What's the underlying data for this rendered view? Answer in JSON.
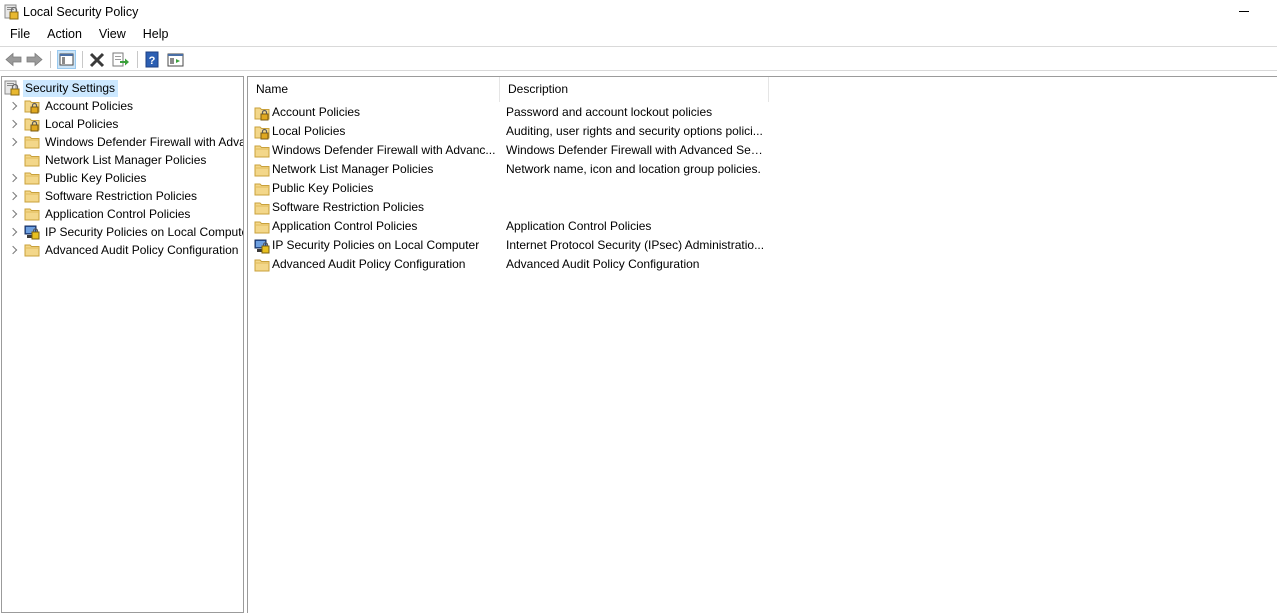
{
  "window": {
    "title": "Local Security Policy"
  },
  "menu": [
    "File",
    "Action",
    "View",
    "Help"
  ],
  "toolbar": {
    "buttons": [
      "back-icon",
      "forward-icon",
      "show-hide-console-tree-icon",
      "delete-icon",
      "export-list-icon",
      "help-icon",
      "properties-icon"
    ]
  },
  "tree": {
    "root": "Security Settings",
    "items": [
      {
        "label": "Account Policies",
        "icon": "lock-folder-icon",
        "expandable": true
      },
      {
        "label": "Local Policies",
        "icon": "lock-folder-icon",
        "expandable": true
      },
      {
        "label": "Windows Defender Firewall with Adva",
        "icon": "folder-icon",
        "expandable": true
      },
      {
        "label": "Network List Manager Policies",
        "icon": "folder-icon",
        "expandable": false
      },
      {
        "label": "Public Key Policies",
        "icon": "folder-icon",
        "expandable": true
      },
      {
        "label": "Software Restriction Policies",
        "icon": "folder-icon",
        "expandable": true
      },
      {
        "label": "Application Control Policies",
        "icon": "folder-icon",
        "expandable": true
      },
      {
        "label": "IP Security Policies on Local Compute",
        "icon": "ip-security-icon",
        "expandable": true
      },
      {
        "label": "Advanced Audit Policy Configuration",
        "icon": "folder-icon",
        "expandable": true
      }
    ]
  },
  "list": {
    "columns": [
      "Name",
      "Description"
    ],
    "rows": [
      {
        "name": "Account Policies",
        "description": "Password and account lockout policies",
        "icon": "lock-folder-icon"
      },
      {
        "name": "Local Policies",
        "description": "Auditing, user rights and security options polici...",
        "icon": "lock-folder-icon"
      },
      {
        "name": "Windows Defender Firewall with Advanc...",
        "description": "Windows Defender Firewall with Advanced Sec...",
        "icon": "folder-icon"
      },
      {
        "name": "Network List Manager Policies",
        "description": "Network name, icon and location group policies.",
        "icon": "folder-icon"
      },
      {
        "name": "Public Key Policies",
        "description": "",
        "icon": "folder-icon"
      },
      {
        "name": "Software Restriction Policies",
        "description": "",
        "icon": "folder-icon"
      },
      {
        "name": "Application Control Policies",
        "description": "Application Control Policies",
        "icon": "folder-icon"
      },
      {
        "name": "IP Security Policies on Local Computer",
        "description": "Internet Protocol Security (IPsec) Administratio...",
        "icon": "ip-security-icon"
      },
      {
        "name": "Advanced Audit Policy Configuration",
        "description": "Advanced Audit Policy Configuration",
        "icon": "folder-icon"
      }
    ]
  }
}
